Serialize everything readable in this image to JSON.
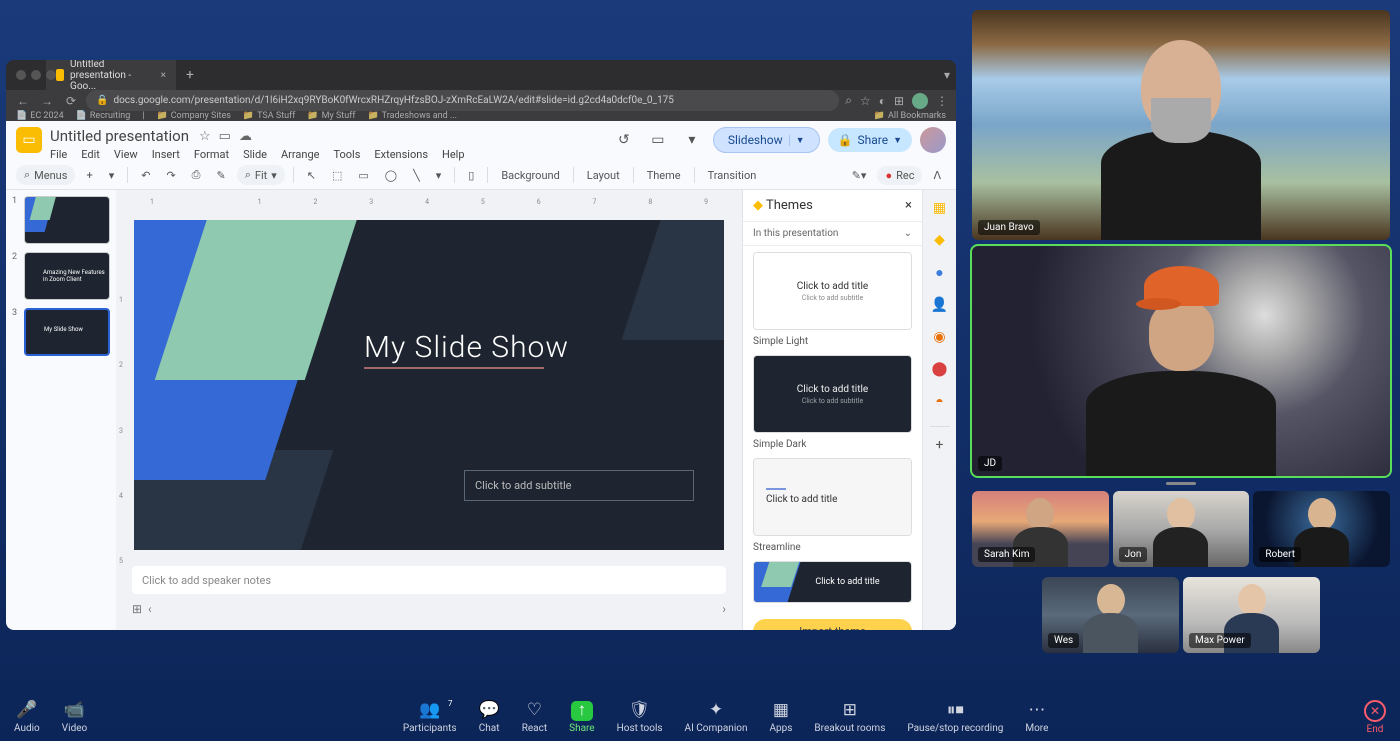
{
  "browser": {
    "tab_title": "Untitled presentation - Goo...",
    "url": "docs.google.com/presentation/d/1l6iH2xq9RYBoK0fWrcxRHZrqyHfzsBOJ-zXmRcEaLW2A/edit#slide=id.g2cd4a0dcf0e_0_175",
    "bookmarks": [
      "EC 2024",
      "Recruiting",
      "Company Sites",
      "TSA Stuff",
      "My Stuff",
      "Tradeshows and ...",
      "All Bookmarks"
    ]
  },
  "slides": {
    "doc_title": "Untitled presentation",
    "menu": [
      "File",
      "Edit",
      "View",
      "Insert",
      "Format",
      "Slide",
      "Arrange",
      "Tools",
      "Extensions",
      "Help"
    ],
    "actions": {
      "slideshow": "Slideshow",
      "share": "Share",
      "menus": "Menus",
      "fit": "Fit",
      "rec": "Rec"
    },
    "toolbar_groups": [
      "Background",
      "Layout",
      "Theme",
      "Transition"
    ],
    "thumbs": [
      {
        "num": "1",
        "title": ""
      },
      {
        "num": "2",
        "title": "Amazing New Features in Zoom Client"
      },
      {
        "num": "3",
        "title": "My Slide Show"
      }
    ],
    "selected_thumb": 3,
    "ruler_h": [
      "1",
      "",
      "1",
      "2",
      "3",
      "4",
      "5",
      "6",
      "7",
      "8",
      "9",
      ""
    ],
    "ruler_v": [
      "",
      "1",
      "2",
      "3",
      "4",
      "5",
      ""
    ],
    "canvas": {
      "title": "My Slide Show",
      "subtitle_placeholder": "Click to add subtitle"
    },
    "notes_placeholder": "Click to add speaker notes",
    "themes": {
      "panel_title": "Themes",
      "section": "In this presentation",
      "cards": [
        {
          "preview_title": "Click to add title",
          "preview_sub": "Click to add subtitle",
          "name": "Simple Light",
          "variant": "light"
        },
        {
          "preview_title": "Click to add title",
          "preview_sub": "Click to add subtitle",
          "name": "Simple Dark",
          "variant": "dark"
        },
        {
          "preview_title": "Click to add title",
          "preview_sub": "",
          "name": "Streamline",
          "variant": "stream"
        },
        {
          "preview_title": "Click to add title",
          "preview_sub": "",
          "name": "",
          "variant": "focal"
        }
      ],
      "import": "Import theme"
    }
  },
  "participants": {
    "large": [
      {
        "name": "Juan Bravo"
      },
      {
        "name": "JD"
      }
    ],
    "small": [
      {
        "name": "Sarah Kim"
      },
      {
        "name": "Jon"
      },
      {
        "name": "Robert"
      },
      {
        "name": "Wes"
      },
      {
        "name": "Max Power"
      }
    ]
  },
  "zoom_toolbar": {
    "left": [
      {
        "icon": "mic",
        "label": "Audio"
      },
      {
        "icon": "video",
        "label": "Video"
      }
    ],
    "center": [
      {
        "icon": "participants",
        "label": "Participants",
        "badge": "7"
      },
      {
        "icon": "chat",
        "label": "Chat"
      },
      {
        "icon": "react",
        "label": "React"
      },
      {
        "icon": "share",
        "label": "Share",
        "green": true
      },
      {
        "icon": "shield",
        "label": "Host tools"
      },
      {
        "icon": "ai",
        "label": "AI Companion"
      },
      {
        "icon": "apps",
        "label": "Apps"
      },
      {
        "icon": "breakout",
        "label": "Breakout rooms"
      },
      {
        "icon": "record",
        "label": "Pause/stop recording"
      },
      {
        "icon": "more",
        "label": "More"
      }
    ],
    "end": "End"
  }
}
